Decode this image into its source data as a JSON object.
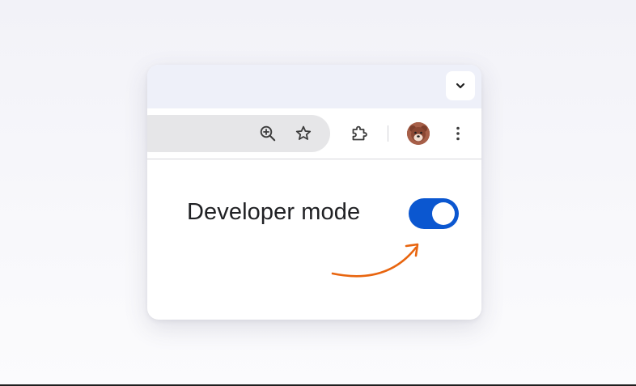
{
  "settings": {
    "developer_mode_label": "Developer mode",
    "developer_mode_enabled": true
  },
  "toolbar": {
    "icons": [
      "zoom-in-icon",
      "bookmark-star-icon",
      "extensions-puzzle-icon",
      "profile-avatar",
      "more-vert-icon"
    ]
  },
  "tabstrip": {
    "icons": [
      "chevron-down-icon"
    ]
  },
  "colors": {
    "accent": "#0b57d0",
    "annotation_arrow": "#e8650f",
    "omnibox": "#e6e6e8",
    "tabstrip": "#eef0f9"
  }
}
